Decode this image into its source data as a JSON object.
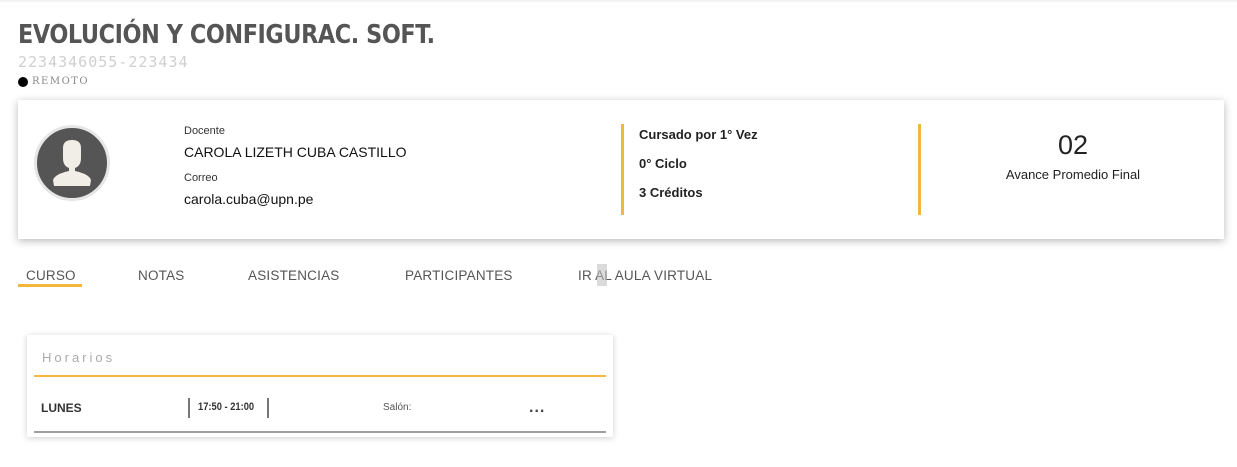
{
  "course": {
    "title": "EVOLUCIÓN Y CONFIGURAC. SOFT.",
    "code": "2234346055-223434",
    "modality": "REMOTO"
  },
  "teacher": {
    "label": "Docente",
    "name": "CAROLA LIZETH CUBA CASTILLO",
    "email_label": "Correo",
    "email": "carola.cuba@upn.pe",
    "avatar_icon": "user-silhouette-icon"
  },
  "meta": {
    "attempt": "Cursado por 1° Vez",
    "cycle": "0° Ciclo",
    "credits": "3 Créditos"
  },
  "average": {
    "value": "02",
    "label": "Avance Promedio Final"
  },
  "tabs": [
    {
      "label": "CURSO",
      "active": true
    },
    {
      "label": "NOTAS",
      "active": false
    },
    {
      "label": "ASISTENCIAS",
      "active": false
    },
    {
      "label": "PARTICIPANTES",
      "active": false
    },
    {
      "label": "IR AL AULA VIRTUAL",
      "active": false
    }
  ],
  "schedule": {
    "title": "Horarios",
    "rows": [
      {
        "day": "LUNES",
        "time": "17:50 - 21:00",
        "room_label": "Salón:",
        "more": "..."
      }
    ]
  },
  "colors": {
    "accent": "#f3b63f",
    "avatar_bg": "#555555"
  }
}
